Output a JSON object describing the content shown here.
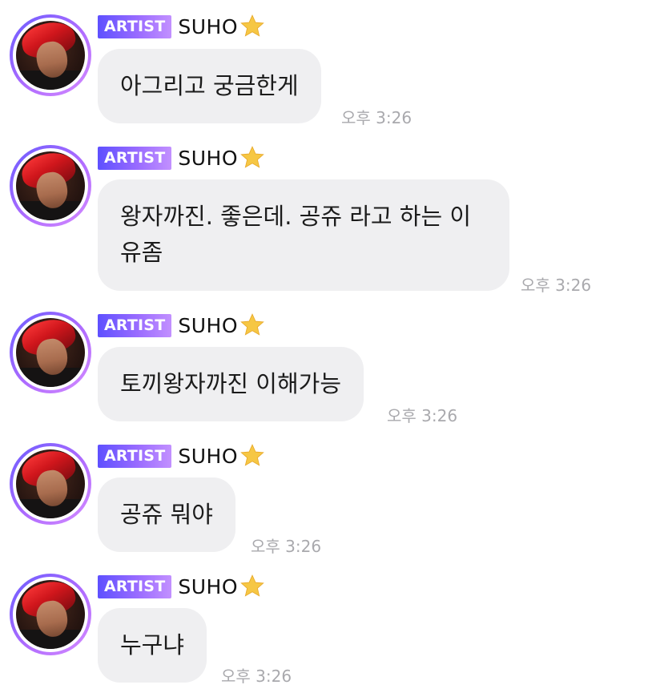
{
  "messages": [
    {
      "badge": "ARTIST",
      "sender": "SUHO",
      "text": "아그리고 궁금한게",
      "time": "오후 3:26"
    },
    {
      "badge": "ARTIST",
      "sender": "SUHO",
      "text": "왕자까진. 좋은데. 공쥬 라고 하는 이유좀",
      "time": "오후 3:26"
    },
    {
      "badge": "ARTIST",
      "sender": "SUHO",
      "text": "토끼왕자까진 이해가능",
      "time": "오후 3:26"
    },
    {
      "badge": "ARTIST",
      "sender": "SUHO",
      "text": "공쥬 뭐야",
      "time": "오후 3:26"
    },
    {
      "badge": "ARTIST",
      "sender": "SUHO",
      "text": "누구냐",
      "time": "오후 3:26"
    }
  ],
  "colors": {
    "badge_gradient_start": "#5e50ff",
    "badge_gradient_end": "#c290ff",
    "bubble_background": "#efeff1",
    "timestamp": "#a9a9ad",
    "star": "#f6c744"
  },
  "icons": {
    "sender_star": "star-icon",
    "avatar": "avatar"
  }
}
